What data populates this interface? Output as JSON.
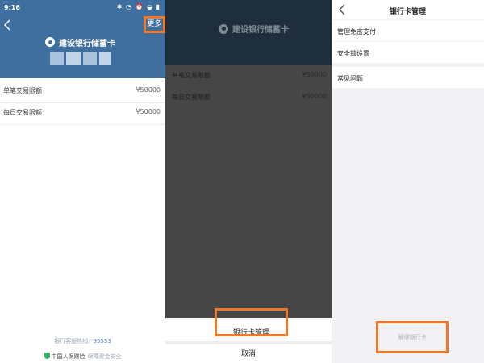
{
  "colors": {
    "accent_highlight": "#f0782a",
    "header_blue": "#3f6f9e",
    "overlay_dark": "#464646",
    "hotline_blue": "#4b7fc0",
    "shield_green": "#3cb46e"
  },
  "screen1": {
    "status_time": "9:16",
    "status_icons": "✱ ◔ ⏰ ◒ ▮",
    "more_label": "更多",
    "bank_name": "建设银行储蓄卡",
    "limits": [
      {
        "label": "单笔交易限额",
        "value": "¥50000"
      },
      {
        "label": "每日交易限额",
        "value": "¥50000"
      }
    ],
    "hotline_label": "银行客服热线:",
    "hotline_number": "95533",
    "insurer_name": "中国人保财险",
    "insurer_note": "保障资金安全"
  },
  "screen2": {
    "bank_name": "建设银行储蓄卡",
    "limits": [
      {
        "label": "单笔交易限额",
        "value": "¥50000"
      },
      {
        "label": "每日交易限额",
        "value": "¥50000"
      }
    ],
    "sheet_option": "银行卡管理",
    "cancel_label": "取消"
  },
  "screen3": {
    "title": "银行卡管理",
    "menu_items": [
      "管理免密支付",
      "安全锁设置",
      "常见问题"
    ],
    "unbind_label": "解绑银行卡"
  }
}
